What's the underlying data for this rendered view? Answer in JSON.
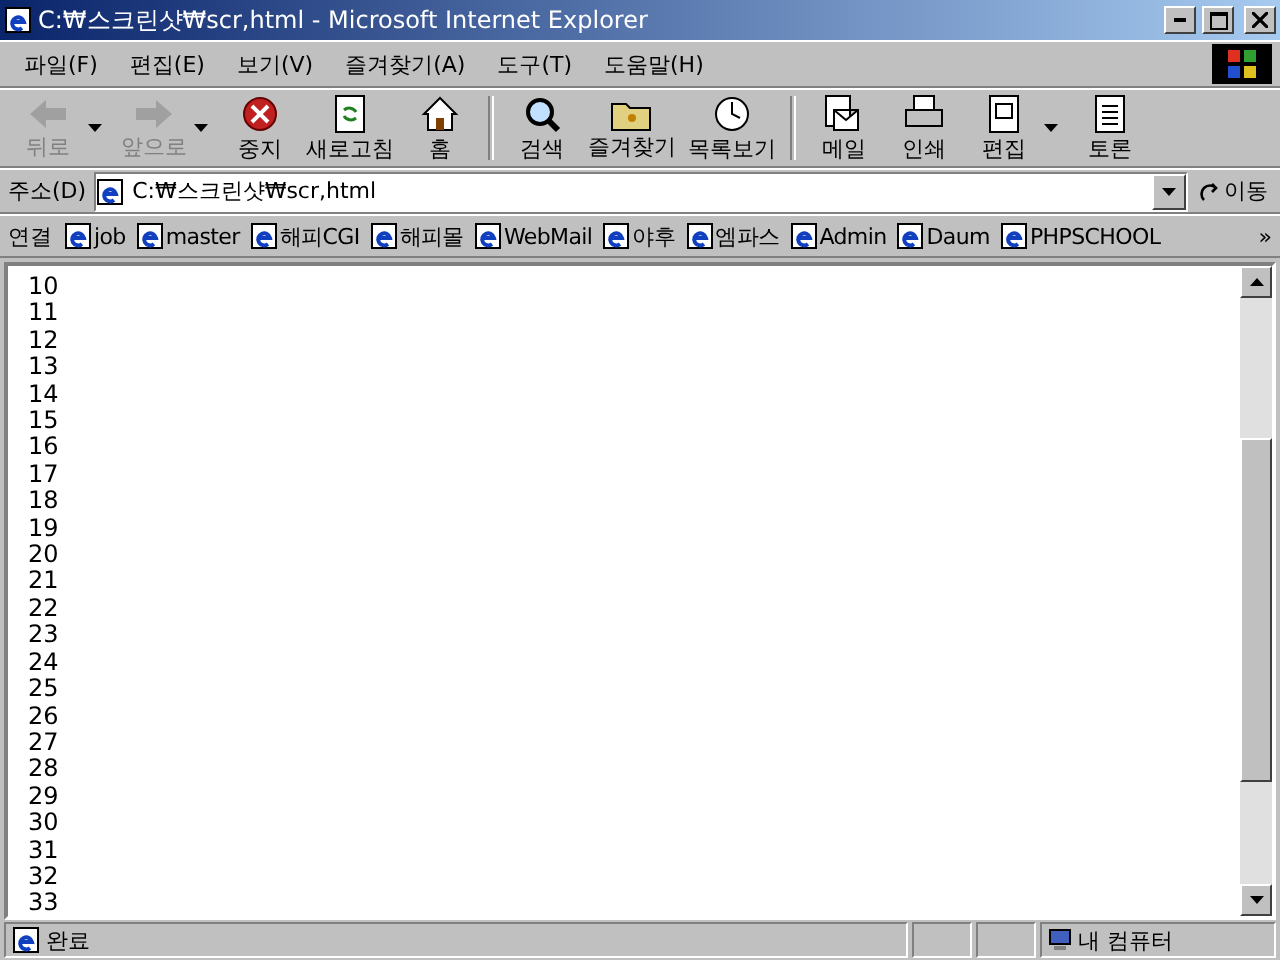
{
  "window": {
    "title": "C:₩스크린샷₩scr,html - Microsoft Internet Explorer"
  },
  "menu": [
    "파일(F)",
    "편집(E)",
    "보기(V)",
    "즐겨찾기(A)",
    "도구(T)",
    "도움말(H)"
  ],
  "toolbar": [
    {
      "label": "뒤로",
      "kind": "back",
      "disabled": true,
      "dropdown": true
    },
    {
      "label": "앞으로",
      "kind": "forward",
      "disabled": true,
      "dropdown": true
    },
    {
      "label": "중지",
      "kind": "stop",
      "disabled": false,
      "dropdown": false
    },
    {
      "label": "새로고침",
      "kind": "refresh",
      "disabled": false,
      "dropdown": false
    },
    {
      "label": "홈",
      "kind": "home",
      "disabled": false,
      "dropdown": false
    },
    {
      "label": "검색",
      "kind": "search",
      "disabled": false,
      "dropdown": false,
      "group_start": true
    },
    {
      "label": "즐겨찾기",
      "kind": "favorites",
      "disabled": false,
      "dropdown": false
    },
    {
      "label": "목록보기",
      "kind": "history",
      "disabled": false,
      "dropdown": false
    },
    {
      "label": "메일",
      "kind": "mail",
      "disabled": false,
      "dropdown": false,
      "group_start": true
    },
    {
      "label": "인쇄",
      "kind": "print",
      "disabled": false,
      "dropdown": false
    },
    {
      "label": "편집",
      "kind": "edit",
      "disabled": false,
      "dropdown": true
    },
    {
      "label": "토론",
      "kind": "discuss",
      "disabled": false,
      "dropdown": false
    }
  ],
  "address": {
    "label": "주소(D)",
    "value": "C:₩스크린샷₩scr,html",
    "go": "이동"
  },
  "links": {
    "label": "연결",
    "items": [
      "job",
      "master",
      "해피CGI",
      "해피몰",
      "WebMail",
      "야후",
      "엠파스",
      "Admin",
      "Daum",
      "PHPSCHOOL"
    ],
    "more": "»"
  },
  "content": {
    "lines": [
      "10",
      "11",
      "12",
      "13",
      "14",
      "15",
      "16",
      "17",
      "18",
      "19",
      "20",
      "21",
      "22",
      "23",
      "24",
      "25",
      "26",
      "27",
      "28",
      "29",
      "30",
      "31",
      "32",
      "33"
    ]
  },
  "status_bar": {
    "text": "완료",
    "zone": "내 컴퓨터"
  }
}
